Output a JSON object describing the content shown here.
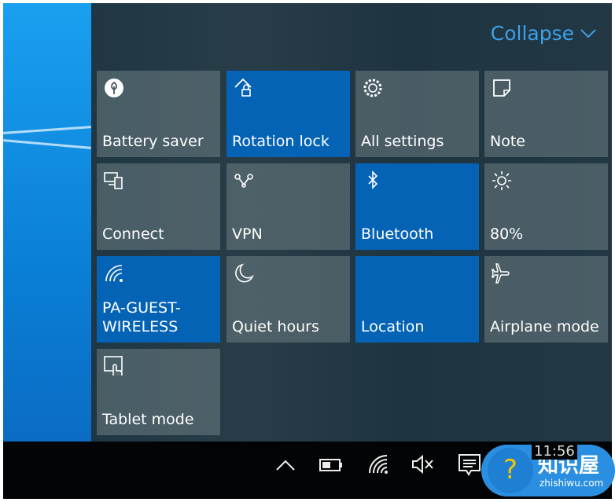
{
  "header": {
    "collapse_label": "Collapse"
  },
  "tiles": [
    {
      "label": "Battery saver",
      "icon": "battery-saver-icon",
      "active": false
    },
    {
      "label": "Rotation lock",
      "icon": "rotation-lock-icon",
      "active": true
    },
    {
      "label": "All settings",
      "icon": "gear-icon",
      "active": false
    },
    {
      "label": "Note",
      "icon": "note-icon",
      "active": false
    },
    {
      "label": "Connect",
      "icon": "connect-icon",
      "active": false
    },
    {
      "label": "VPN",
      "icon": "vpn-icon",
      "active": false
    },
    {
      "label": "Bluetooth",
      "icon": "bluetooth-icon",
      "active": true
    },
    {
      "label": "80%",
      "icon": "brightness-icon",
      "active": false
    },
    {
      "label": "PA-GUEST-\nWIRELESS",
      "icon": "wifi-icon",
      "active": true
    },
    {
      "label": "Quiet hours",
      "icon": "moon-icon",
      "active": false
    },
    {
      "label": "Location",
      "icon": "location-icon",
      "active": true
    },
    {
      "label": "Airplane mode",
      "icon": "airplane-icon",
      "active": false
    },
    {
      "label": "Tablet mode",
      "icon": "tablet-mode-icon",
      "active": false
    }
  ],
  "taskbar": {
    "clock": "11:56",
    "icons": [
      "chevron-up-icon",
      "battery-icon",
      "wifi-icon",
      "volume-muted-icon",
      "action-center-icon"
    ]
  },
  "watermark": {
    "name": "知识屋",
    "url": "zhishiwu.com"
  },
  "colors": {
    "accent": "#0563b6",
    "collapse": "#3ea0e8"
  }
}
